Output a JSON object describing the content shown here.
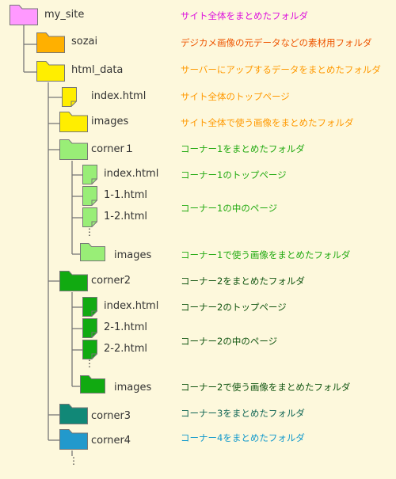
{
  "colors": {
    "magenta": "#ff99ff",
    "orange": "#ffb000",
    "yellow": "#ffee00",
    "lightgreen": "#99ee77",
    "green": "#11aa11",
    "teal": "#118877",
    "blue": "#2299cc",
    "line": "#777777"
  },
  "nodes": {
    "my_site": {
      "label": "my_site",
      "desc": "サイト全体をまとめたフォルダ",
      "icon": "folder-icon"
    },
    "sozai": {
      "label": "sozai",
      "desc": "デジカメ画像の元データなどの素材用フォルダ",
      "icon": "folder-icon"
    },
    "html_data": {
      "label": "html_data",
      "desc": "サーバーにアップするデータをまとめたフォルダ",
      "icon": "folder-icon"
    },
    "index_top": {
      "label": "index.html",
      "desc": "サイト全体のトップページ",
      "icon": "file-icon"
    },
    "images_top": {
      "label": "images",
      "desc": "サイト全体で使う画像をまとめたフォルダ",
      "icon": "folder-icon"
    },
    "corner1": {
      "label": "corner１",
      "desc": "コーナー1をまとめたフォルダ",
      "icon": "folder-icon"
    },
    "c1_index": {
      "label": "index.html",
      "desc": "コーナー1のトップページ",
      "icon": "file-icon"
    },
    "c1_11": {
      "label": "1-1.html",
      "icon": "file-icon"
    },
    "c1_12": {
      "label": "1-2.html",
      "icon": "file-icon"
    },
    "c1_pages_desc": "コーナー1の中のページ",
    "c1_images": {
      "label": "images",
      "desc": "コーナー1で使う画像をまとめたフォルダ",
      "icon": "folder-icon"
    },
    "corner2": {
      "label": "corner2",
      "desc": "コーナー2をまとめたフォルダ",
      "icon": "folder-icon"
    },
    "c2_index": {
      "label": "index.html",
      "desc": "コーナー2のトップページ",
      "icon": "file-icon"
    },
    "c2_21": {
      "label": "2-1.html",
      "icon": "file-icon"
    },
    "c2_22": {
      "label": "2-2.html",
      "icon": "file-icon"
    },
    "c2_pages_desc": "コーナー2の中のページ",
    "c2_images": {
      "label": "images",
      "desc": "コーナー2で使う画像をまとめたフォルダ",
      "icon": "folder-icon"
    },
    "corner3": {
      "label": "corner3",
      "desc": "コーナー3をまとめたフォルダ",
      "icon": "folder-icon"
    },
    "corner4": {
      "label": "corner4",
      "desc": "コーナー4をまとめたフォルダ",
      "icon": "folder-icon"
    }
  },
  "ellipsis": "⋮"
}
